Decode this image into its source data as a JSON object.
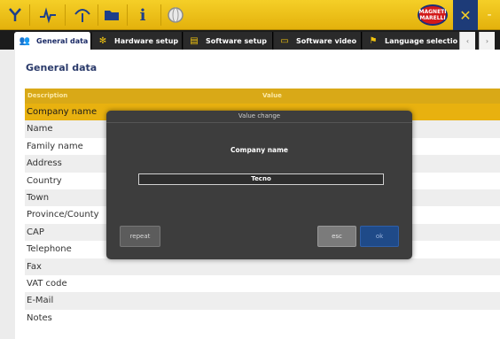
{
  "toolbar": {
    "icons": [
      "diagnosis-icon",
      "waveform-icon",
      "antenna-icon",
      "folder-icon",
      "info-icon",
      "globe-icon"
    ],
    "logo_text": "MAGNETI MARELLI",
    "tools_icon": "tools-icon",
    "minus_label": "-",
    "colors": {
      "background": "#e8b612",
      "icon": "#1e3f8a"
    }
  },
  "tabs": [
    {
      "label": "General data",
      "icon": "people-icon",
      "active": true
    },
    {
      "label": "Hardware setup",
      "icon": "gear-icon",
      "active": false
    },
    {
      "label": "Software setup",
      "icon": "document-icon",
      "active": false
    },
    {
      "label": "Software video",
      "icon": "chat-icon",
      "active": false
    },
    {
      "label": "Language selectio",
      "icon": "flag-icon",
      "active": false
    }
  ],
  "tab_nav": {
    "prev": "‹",
    "next": "›"
  },
  "page": {
    "title": "General data",
    "table": {
      "headers": [
        "Description",
        "Value"
      ],
      "rows": [
        "Company name",
        "Name",
        "Family name",
        "Address",
        "Country",
        "Town",
        "Province/County",
        "CAP",
        "Telephone",
        "Fax",
        "VAT code",
        "E-Mail",
        "Notes"
      ],
      "selected_row": "Company name"
    }
  },
  "modal": {
    "title": "Value change",
    "field_label": "Company name",
    "value": "Tecno",
    "buttons": {
      "repeat": "repeat",
      "esc": "esc",
      "ok": "ok"
    }
  }
}
